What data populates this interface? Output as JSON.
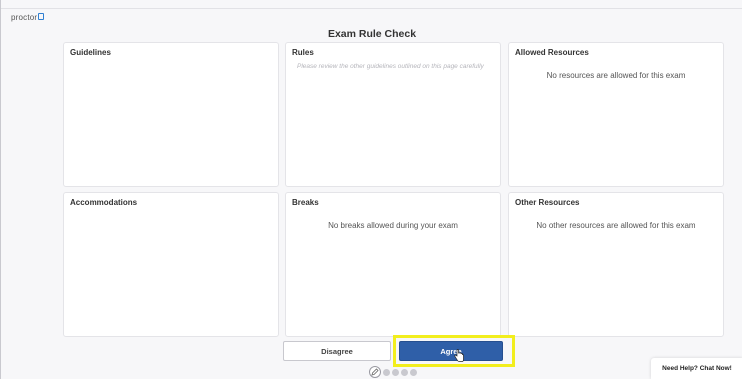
{
  "app": {
    "logo_text": "proctor"
  },
  "page": {
    "title": "Exam Rule Check"
  },
  "cards": {
    "guidelines": {
      "title": "Guidelines"
    },
    "rules": {
      "title": "Rules",
      "note": "Please review the other guidelines outlined on this page carefully"
    },
    "allowed_resources": {
      "title": "Allowed Resources",
      "text": "No resources are allowed for this exam"
    },
    "accommodations": {
      "title": "Accommodations"
    },
    "breaks": {
      "title": "Breaks",
      "text": "No breaks allowed during your exam"
    },
    "other_resources": {
      "title": "Other Resources",
      "text": "No other resources are allowed for this exam"
    }
  },
  "actions": {
    "disagree_label": "Disagree",
    "agree_label": "Agree"
  },
  "chat": {
    "label": "Need Help? Chat Now!"
  },
  "colors": {
    "primary": "#2f5fa8",
    "highlight": "#f2ee1d",
    "logo_accent": "#2f7fd1"
  }
}
